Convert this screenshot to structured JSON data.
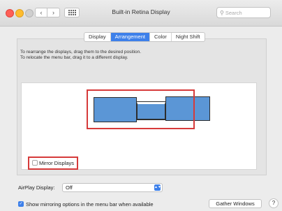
{
  "window": {
    "title": "Built-in Retina Display",
    "search_placeholder": "Search",
    "nav_back": "‹",
    "nav_forward": "›"
  },
  "tabs": [
    {
      "label": "Display",
      "active": false
    },
    {
      "label": "Arrangement",
      "active": true
    },
    {
      "label": "Color",
      "active": false
    },
    {
      "label": "Night Shift",
      "active": false
    }
  ],
  "arrangement": {
    "instruction_1": "To rearrange the displays, drag them to the desired position.",
    "instruction_2": "To relocate the menu bar, drag it to a different display.",
    "mirror_label": "Mirror Displays",
    "mirror_checked": false
  },
  "airplay": {
    "label": "AirPlay Display:",
    "value": "Off"
  },
  "footer": {
    "show_mirroring_label": "Show mirroring options in the menu bar when available",
    "show_mirroring_checked": true,
    "gather_button": "Gather Windows",
    "help_button": "?"
  },
  "colors": {
    "accent": "#3d80ea",
    "display_fill": "#5b96d6",
    "highlight": "#d63a3a"
  }
}
